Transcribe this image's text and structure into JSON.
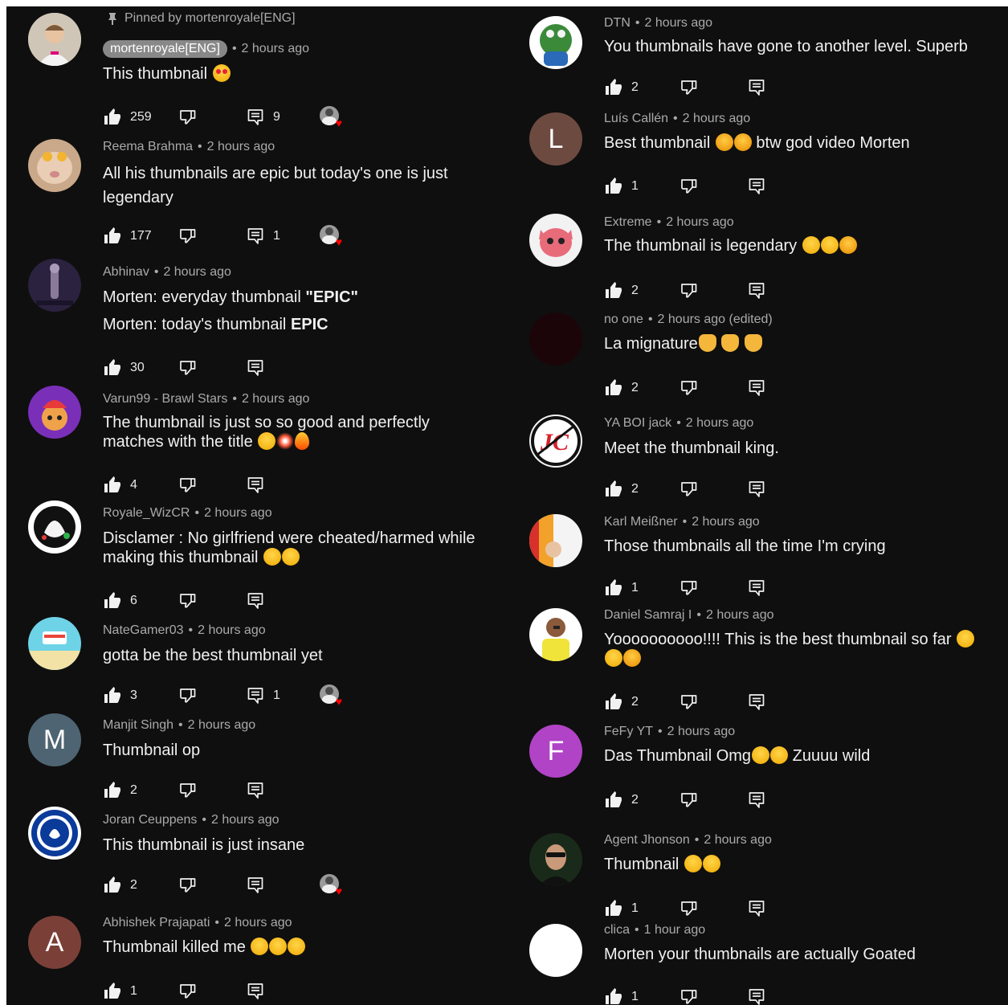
{
  "colors": {
    "background": "#0f0f0f",
    "text": "#f1f1f1",
    "secondary_text": "#aaaaaa",
    "heart": "#ff0000"
  },
  "left_comments": [
    {
      "pinned": "Pinned by mortenroyale[ENG]",
      "author": "mortenroyale[ENG]",
      "time": "2 hours ago",
      "lines": [
        "This thumbnail"
      ],
      "likes": "259",
      "replies": "9",
      "creator_heart": true
    },
    {
      "author": "Reema Brahma",
      "time": "2 hours ago",
      "lines": [
        "All his thumbnails are epic but today's one is just",
        "legendary"
      ],
      "likes": "177",
      "replies": "1",
      "creator_heart": true
    },
    {
      "author": "Abhinav",
      "time": "2 hours ago",
      "line1_plain": "Morten: everyday thumbnail ",
      "line1_bold": "\"EPIC\"",
      "line2_plain": "Morten: today's thumbnail ",
      "line2_bold": "EPIC",
      "likes": "30"
    },
    {
      "author": "Varun99 - Brawl Stars",
      "time": "2 hours ago",
      "lines": [
        "The thumbnail is just so so good and perfectly",
        "matches with the title"
      ],
      "likes": "4"
    },
    {
      "author": "Royale_WizCR",
      "time": "2 hours ago",
      "lines": [
        "Disclamer : No girlfriend were cheated/harmed while",
        "making this thumbnail"
      ],
      "likes": "6"
    },
    {
      "author": "NateGamer03",
      "time": "2 hours ago",
      "lines": [
        "gotta be the best thumbnail yet"
      ],
      "likes": "3",
      "replies": "1",
      "creator_heart": true
    },
    {
      "author": "Manjit Singh",
      "time": "2 hours ago",
      "initial": "M",
      "lines": [
        "Thumbnail op"
      ],
      "likes": "2"
    },
    {
      "author": "Joran Ceuppens",
      "time": "2 hours ago",
      "lines": [
        "This thumbnail is just insane"
      ],
      "likes": "2",
      "creator_heart": true
    },
    {
      "author": "Abhishek Prajapati",
      "time": "2 hours ago",
      "initial": "A",
      "lines": [
        "Thumbnail killed me"
      ],
      "likes": "1"
    }
  ],
  "right_comments": [
    {
      "author": "DTN",
      "time": "2 hours ago",
      "lines": [
        "You thumbnails have gone to another level. Superb"
      ],
      "likes": "2"
    },
    {
      "author": "Luís Callén",
      "time": "2 hours ago",
      "initial": "L",
      "text_a": "Best thumbnail ",
      "text_b": " btw god video Morten",
      "likes": "1"
    },
    {
      "author": "Extreme",
      "time": "2 hours ago",
      "lines": [
        "The thumbnail is legendary "
      ],
      "likes": "2"
    },
    {
      "author": "no one",
      "time": "2 hours ago (edited)",
      "lines": [
        "La mignature"
      ],
      "likes": "2"
    },
    {
      "author": "YA BOI jack",
      "time": "2 hours ago",
      "lines": [
        "Meet the thumbnail king."
      ],
      "likes": "2"
    },
    {
      "author": "Karl Meißner",
      "time": "2 hours ago",
      "lines": [
        "Those thumbnails all the time I'm crying"
      ],
      "likes": "1"
    },
    {
      "author": "Daniel Samraj I",
      "time": "2 hours ago",
      "lines": [
        "Yoooooooooo!!!! This is the best thumbnail so far "
      ],
      "likes": "2"
    },
    {
      "author": "FeFy YT",
      "time": "2 hours ago",
      "initial": "F",
      "text_a": "Das Thumbnail Omg",
      "text_b": " Zuuuu wild",
      "likes": "2"
    },
    {
      "author": "Agent Jhonson",
      "time": "2 hours ago",
      "lines": [
        "Thumbnail "
      ],
      "likes": "1"
    },
    {
      "author": "clica",
      "time": "1 hour ago",
      "lines": [
        "Morten your thumbnails are actually Goated"
      ],
      "likes": "1"
    }
  ]
}
